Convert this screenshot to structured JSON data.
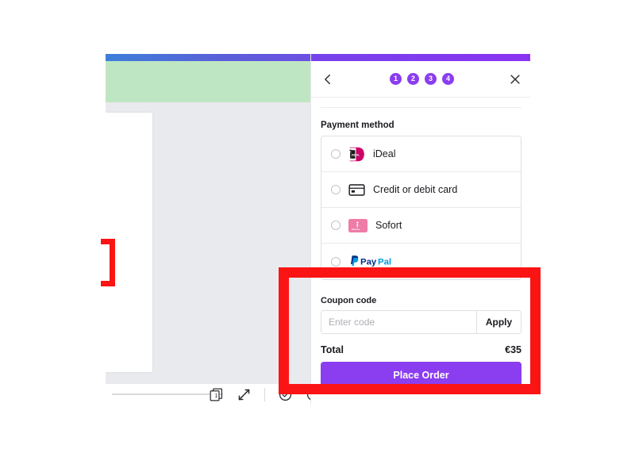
{
  "theme": {
    "accent_purple": "#8b3df0",
    "gradient_start": "#3d7fd9",
    "gradient_end": "#8b33f2",
    "annotation_red": "#fb1414",
    "banner_green": "#bfe6c3",
    "canvas_gray": "#e9eaee"
  },
  "editor": {
    "banner_edit_icon": "pencil-icon",
    "toolbar": {
      "page_number": "1",
      "page_icon": "pages-stack-icon",
      "fullscreen_icon": "expand-arrows-icon",
      "check_icon": "check-circle-icon",
      "help_icon": "question-circle-icon",
      "zoom_slider": "zoom-slider"
    }
  },
  "panel": {
    "back_icon": "chevron-left-icon",
    "close_icon": "close-x-icon",
    "steps": [
      {
        "label": "1",
        "active": true
      },
      {
        "label": "2",
        "active": true
      },
      {
        "label": "3",
        "active": true
      },
      {
        "label": "4",
        "active": true
      }
    ],
    "payment": {
      "section_title": "Payment method",
      "methods": [
        {
          "label": "iDeal",
          "logo": "ideal-logo",
          "selected": false
        },
        {
          "label": "Credit or debit card",
          "logo": "credit-card-icon",
          "selected": false
        },
        {
          "label": "Sofort",
          "logo": "sofort-klarna-logo",
          "selected": false
        },
        {
          "label": "PayPal",
          "logo": "paypal-logo",
          "selected": false
        }
      ]
    },
    "coupon": {
      "label": "Coupon code",
      "placeholder": "Enter code",
      "value": "",
      "apply_label": "Apply"
    },
    "summary": {
      "total_label": "Total",
      "total_value": "€35"
    },
    "place_order_label": "Place Order"
  }
}
